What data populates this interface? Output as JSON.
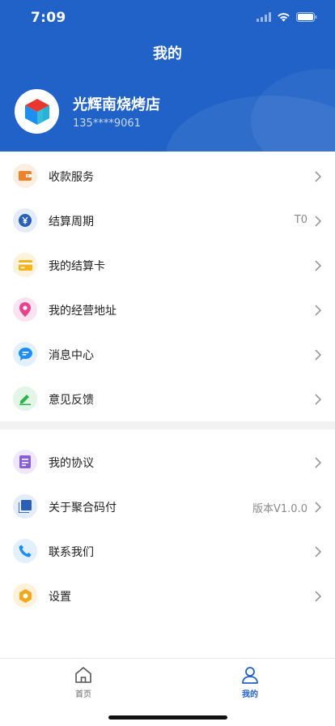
{
  "status_bar": {
    "time": "7:09"
  },
  "nav": {
    "title": "我的"
  },
  "profile": {
    "store_name": "光辉南烧烤店",
    "phone": "135****9061"
  },
  "menu_group_1": [
    {
      "label": "收款服务",
      "value": "",
      "icon": "wallet-icon",
      "color": "#f0812b",
      "bg": "#fdeee2"
    },
    {
      "label": "结算周期",
      "value": "T0",
      "icon": "yuan-icon",
      "color": "#2a5fb8",
      "bg": "#e4ecf8"
    },
    {
      "label": "我的结算卡",
      "value": "",
      "icon": "card-icon",
      "color": "#f5b41d",
      "bg": "#fdf3dc"
    },
    {
      "label": "我的经营地址",
      "value": "",
      "icon": "location-pin-icon",
      "color": "#e8418e",
      "bg": "#fbe4ef"
    },
    {
      "label": "消息中心",
      "value": "",
      "icon": "message-icon",
      "color": "#1f8ef1",
      "bg": "#e2f0fd"
    },
    {
      "label": "意见反馈",
      "value": "",
      "icon": "feedback-icon",
      "color": "#2bb44a",
      "bg": "#e2f5e6"
    }
  ],
  "menu_group_2": [
    {
      "label": "我的协议",
      "value": "",
      "icon": "agreement-icon",
      "color": "#8a5fd6",
      "bg": "#efe7fb"
    },
    {
      "label": "关于聚合码付",
      "value": "版本V1.0.0",
      "icon": "about-icon",
      "color": "#2a5fb8",
      "bg": "#e4ecf8"
    },
    {
      "label": "联系我们",
      "value": "",
      "icon": "phone-icon",
      "color": "#1f8ef1",
      "bg": "#e2f0fd"
    },
    {
      "label": "设置",
      "value": "",
      "icon": "settings-gear-icon",
      "color": "#f0a81c",
      "bg": "#fdf1d9"
    }
  ],
  "tabbar": {
    "home_label": "首页",
    "mine_label": "我的"
  },
  "colors": {
    "brand": "#2062c8",
    "tab_active": "#2062c8",
    "divider": "#f2f2f2"
  }
}
